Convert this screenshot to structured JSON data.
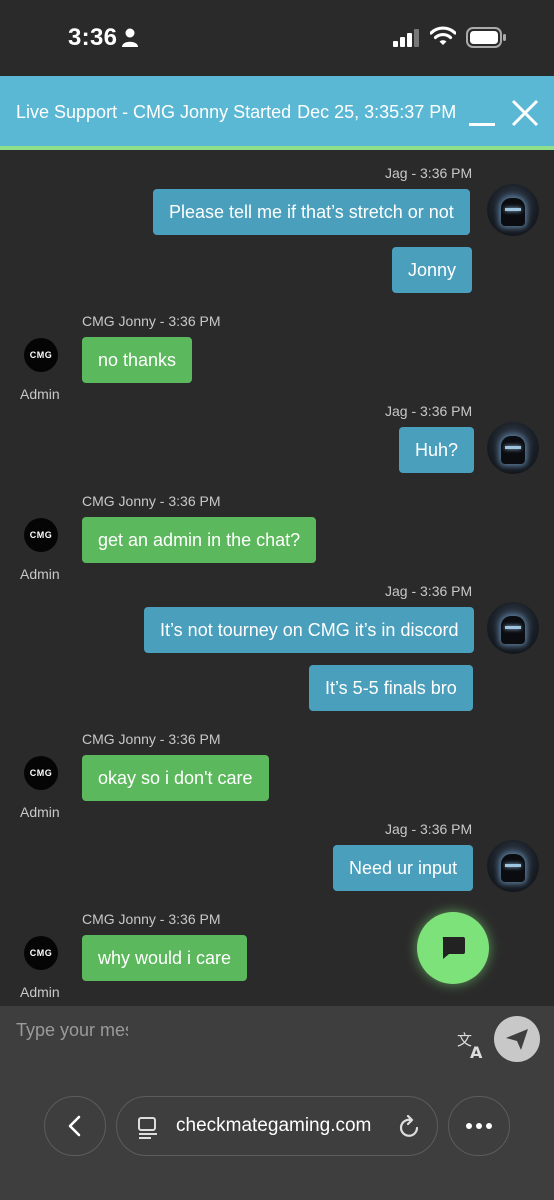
{
  "status_bar": {
    "time": "3:36"
  },
  "header": {
    "title": "Live Support - CMG Jonny Started",
    "date": "Dec 25, 3:35:37 PM"
  },
  "messages": [
    {
      "sender": "Jag",
      "meta": "Jag - 3:36 PM",
      "bubbles": [
        "Please tell me if that’s stretch or not",
        "Jonny"
      ]
    },
    {
      "sender": "CMG Jonny",
      "meta": "CMG Jonny - 3:36 PM",
      "bubbles": [
        "no thanks"
      ],
      "role_label": "Admin",
      "avatar_text": "CMG"
    },
    {
      "sender": "Jag",
      "meta": "Jag - 3:36 PM",
      "bubbles": [
        "Huh?"
      ]
    },
    {
      "sender": "CMG Jonny",
      "meta": "CMG Jonny - 3:36 PM",
      "bubbles": [
        "get an admin in the chat?"
      ],
      "role_label": "Admin",
      "avatar_text": "CMG"
    },
    {
      "sender": "Jag",
      "meta": "Jag - 3:36 PM",
      "bubbles": [
        "It’s not tourney on CMG it’s in discord",
        "It’s 5-5 finals bro"
      ]
    },
    {
      "sender": "CMG Jonny",
      "meta": "CMG Jonny - 3:36 PM",
      "bubbles": [
        "okay so i don't care"
      ],
      "role_label": "Admin",
      "avatar_text": "CMG"
    },
    {
      "sender": "Jag",
      "meta": "Jag - 3:36 PM",
      "bubbles": [
        "Need ur input"
      ]
    },
    {
      "sender": "CMG Jonny",
      "meta": "CMG Jonny - 3:36 PM",
      "bubbles": [
        "why would i care"
      ],
      "role_label": "Admin",
      "avatar_text": "CMG"
    }
  ],
  "composer": {
    "placeholder": "Type your mes"
  },
  "browser": {
    "url": "checkmategaming.com"
  },
  "colors": {
    "header": "#5bb8d4",
    "user_bubble": "#4a9fbd",
    "admin_bubble": "#5cb85c",
    "fab": "#7ee27a",
    "background": "#2a2a2a"
  }
}
